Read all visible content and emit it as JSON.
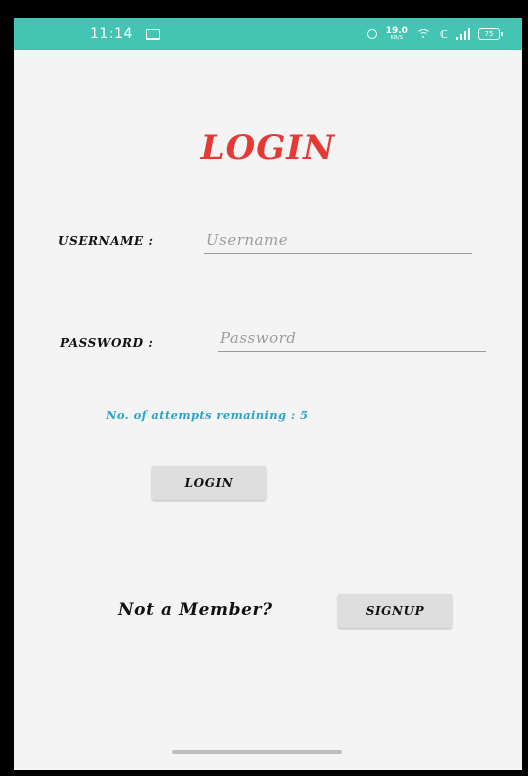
{
  "status_bar": {
    "time": "11:14",
    "net_speed_value": "19.0",
    "net_speed_unit": "KB/S",
    "vowifi": "ℂ",
    "battery": "75",
    "color": "#44c4b3",
    "icons": [
      "laptop-icon",
      "alarm-icon",
      "wifi-icon",
      "vowifi-icon",
      "signal-icon",
      "battery-icon"
    ]
  },
  "title": {
    "text": "LOGIN",
    "color": "#e53935"
  },
  "form": {
    "username_label": "USERNAME :",
    "username_placeholder": "Username",
    "username_value": "",
    "password_label": "PASSWORD :",
    "password_placeholder": "Password",
    "password_value": ""
  },
  "attempts": {
    "text": "No. of attempts remaining : 5",
    "color": "#29a3c7"
  },
  "buttons": {
    "login_label": "LOGIN",
    "signup_label": "SIGNUP"
  },
  "footer": {
    "not_member_text": "Not a Member?"
  }
}
